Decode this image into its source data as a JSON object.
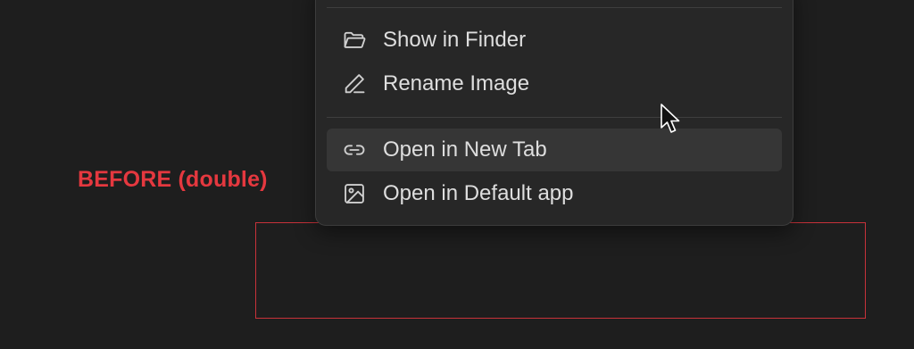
{
  "annotation": {
    "label": "BEFORE (double)",
    "color": "#e5383f"
  },
  "menu": {
    "items": [
      {
        "label": "Show in Finder",
        "icon": "folder-open-icon"
      },
      {
        "label": "Rename Image",
        "icon": "pencil-icon"
      },
      {
        "label": "Open in New Tab",
        "icon": "link-icon",
        "hovered": true
      },
      {
        "label": "Open in Default app",
        "icon": "image-icon"
      }
    ]
  },
  "colors": {
    "background": "#1e1e1e",
    "menu_background": "#272727",
    "hover_background": "#363636",
    "text": "#dedede",
    "icon": "#cfcfcf",
    "highlight_border": "#c8323a"
  }
}
